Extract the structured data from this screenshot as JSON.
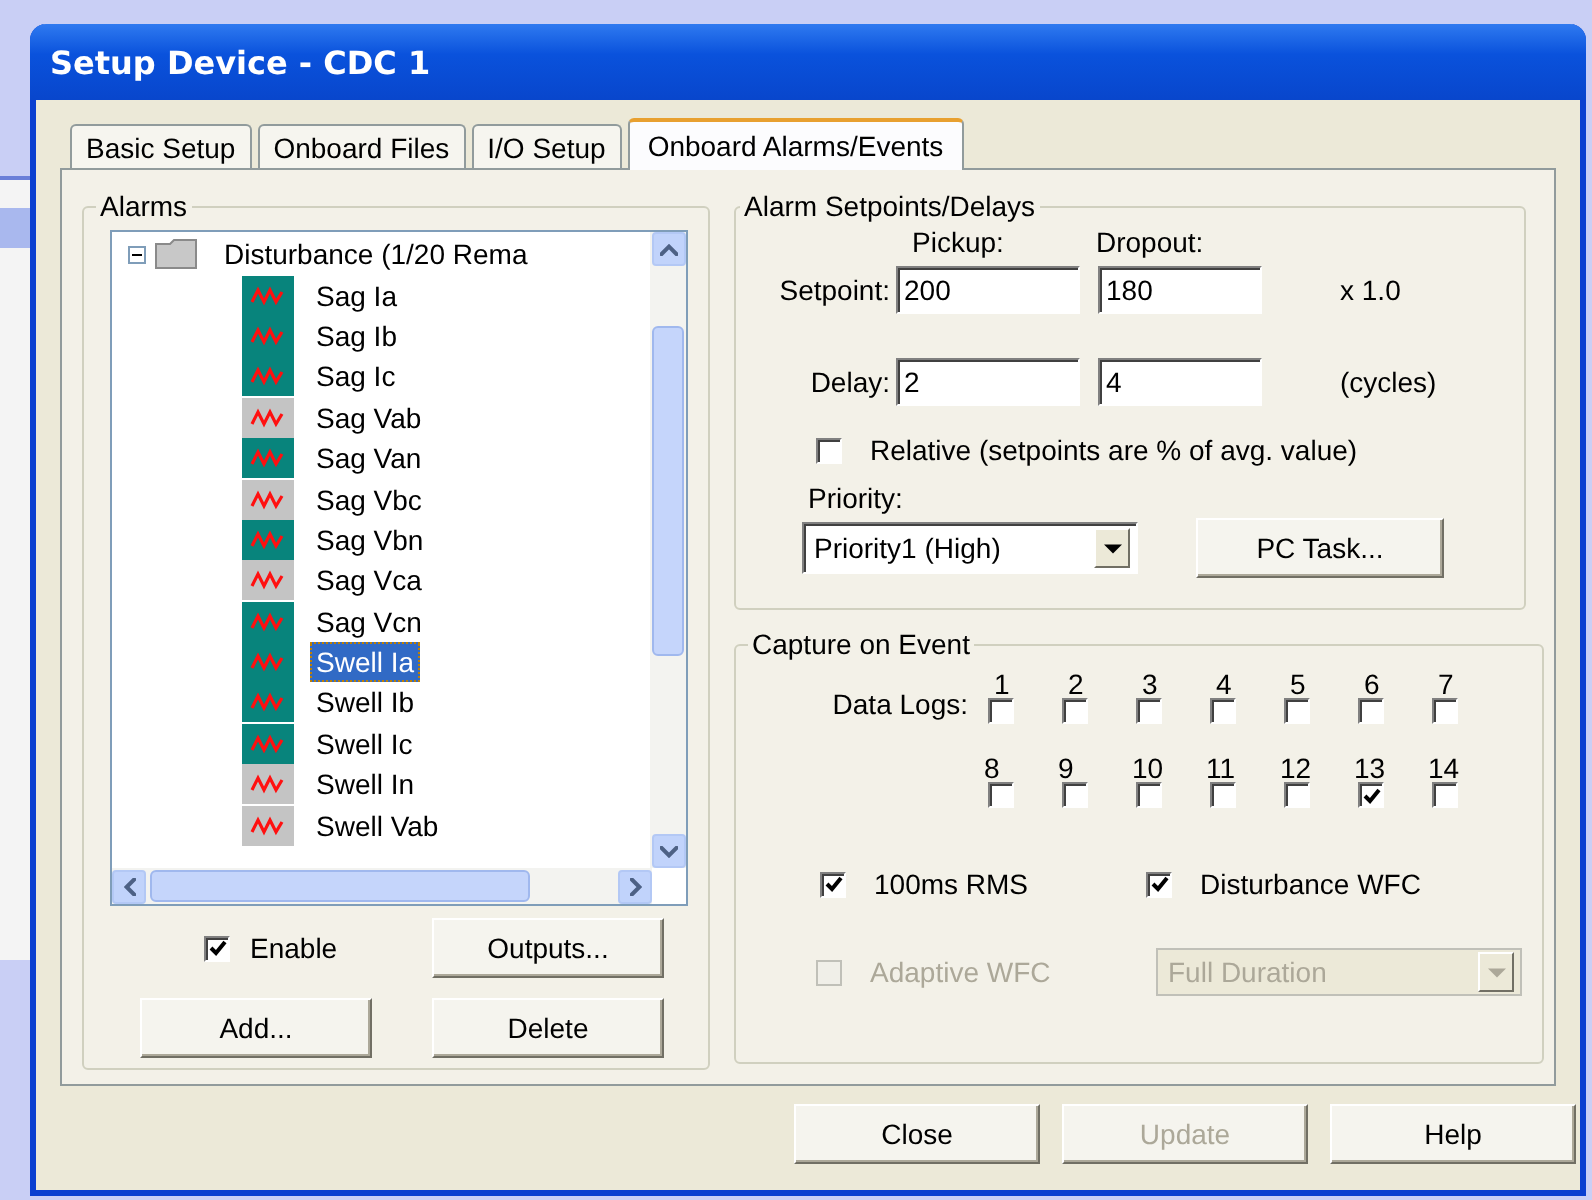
{
  "window": {
    "title": "Setup Device - CDC 1"
  },
  "tabs": [
    {
      "label": "Basic Setup",
      "selected": false
    },
    {
      "label": "Onboard Files",
      "selected": false
    },
    {
      "label": "I/O Setup",
      "selected": false
    },
    {
      "label": "Onboard Alarms/Events",
      "selected": true
    }
  ],
  "alarms": {
    "title": "Alarms",
    "tree": {
      "label": "Disturbance (1/20 Rema",
      "expanded": true,
      "children": [
        {
          "label": "Sag Ia",
          "active": true,
          "selected": false
        },
        {
          "label": "Sag Ib",
          "active": true,
          "selected": false
        },
        {
          "label": "Sag Ic",
          "active": true,
          "selected": false
        },
        {
          "label": "Sag Vab",
          "active": false,
          "selected": false
        },
        {
          "label": "Sag Van",
          "active": true,
          "selected": false
        },
        {
          "label": "Sag Vbc",
          "active": false,
          "selected": false
        },
        {
          "label": "Sag Vbn",
          "active": true,
          "selected": false
        },
        {
          "label": "Sag Vca",
          "active": false,
          "selected": false
        },
        {
          "label": "Sag Vcn",
          "active": true,
          "selected": false
        },
        {
          "label": "Swell Ia",
          "active": true,
          "selected": true
        },
        {
          "label": "Swell Ib",
          "active": true,
          "selected": false
        },
        {
          "label": "Swell Ic",
          "active": true,
          "selected": false
        },
        {
          "label": "Swell In",
          "active": false,
          "selected": false
        },
        {
          "label": "Swell Vab",
          "active": false,
          "selected": false
        }
      ]
    },
    "enable": {
      "label": "Enable",
      "checked": true
    },
    "outputs_button": "Outputs...",
    "add_button": "Add...",
    "delete_button": "Delete"
  },
  "setpoints": {
    "title": "Alarm Setpoints/Delays",
    "columns": [
      "Pickup:",
      "Dropout:"
    ],
    "rows": [
      {
        "label": "Setpoint:",
        "pickup": "200",
        "dropout": "180",
        "unit": "x 1.0"
      },
      {
        "label": "Delay:",
        "pickup": "2",
        "dropout": "4",
        "unit": "(cycles)"
      }
    ],
    "relative": {
      "label": "Relative (setpoints are % of avg. value)",
      "checked": false
    },
    "priority": {
      "label": "Priority:",
      "value": "Priority1 (High)"
    },
    "pc_task_button": "PC Task..."
  },
  "capture": {
    "title": "Capture on Event",
    "data_logs_label": "Data Logs:",
    "data_logs": [
      {
        "label": "1",
        "checked": false
      },
      {
        "label": "2",
        "checked": false
      },
      {
        "label": "3",
        "checked": false
      },
      {
        "label": "4",
        "checked": false
      },
      {
        "label": "5",
        "checked": false
      },
      {
        "label": "6",
        "checked": false
      },
      {
        "label": "7",
        "checked": false
      },
      {
        "label": "8",
        "checked": false
      },
      {
        "label": "9",
        "checked": false
      },
      {
        "label": "10",
        "checked": false
      },
      {
        "label": "11",
        "checked": false
      },
      {
        "label": "12",
        "checked": false
      },
      {
        "label": "13",
        "checked": true
      },
      {
        "label": "14",
        "checked": false
      }
    ],
    "options": [
      {
        "label": "100ms RMS",
        "checked": true
      },
      {
        "label": "Disturbance WFC",
        "checked": true
      }
    ],
    "adaptive": {
      "label": "Adaptive WFC",
      "checked": false,
      "disabled": true
    },
    "duration": {
      "value": "Full Duration",
      "disabled": true
    }
  },
  "footer_buttons": [
    {
      "label": "Close",
      "disabled": false
    },
    {
      "label": "Update",
      "disabled": true
    },
    {
      "label": "Help",
      "disabled": false
    }
  ]
}
